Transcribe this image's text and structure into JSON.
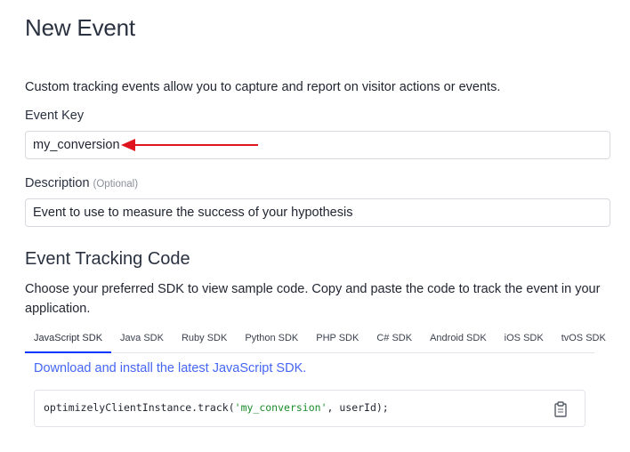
{
  "page": {
    "title": "New Event",
    "intro": "Custom tracking events allow you to capture and report on visitor actions or events."
  },
  "form": {
    "event_key_label": "Event Key",
    "event_key_value": "my_conversion",
    "description_label": "Description",
    "description_optional": "(Optional)",
    "description_value": "Event to use to measure the success of your hypothesis"
  },
  "annotation": {
    "arrow_color": "#e0141e"
  },
  "tracking": {
    "title": "Event Tracking Code",
    "description": "Choose your preferred SDK to view sample code. Copy and paste the code to track the event in your application.",
    "tabs": [
      {
        "label": "JavaScript SDK"
      },
      {
        "label": "Java SDK"
      },
      {
        "label": "Ruby SDK"
      },
      {
        "label": "Python SDK"
      },
      {
        "label": "PHP SDK"
      },
      {
        "label": "C# SDK"
      },
      {
        "label": "Android SDK"
      },
      {
        "label": "iOS SDK"
      },
      {
        "label": "tvOS SDK"
      }
    ],
    "active_tab": "JavaScript SDK",
    "sdk_link": "Download and install the latest JavaScript SDK.",
    "code": {
      "prefix": "optimizelyClientInstance.track(",
      "string_arg": "'my_conversion'",
      "suffix": ", userId);"
    },
    "copy_icon": "clipboard-icon"
  },
  "colors": {
    "link": "#4666f5",
    "active_tab_underline": "#0037ff",
    "code_string": "#1a8c2a"
  }
}
